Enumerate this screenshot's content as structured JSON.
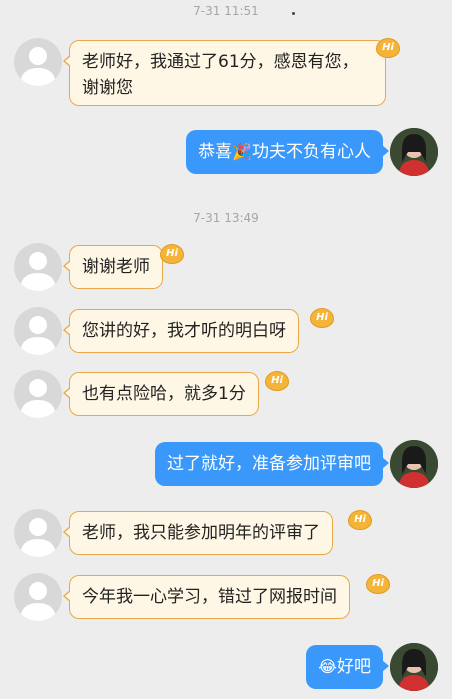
{
  "timestamps": [
    "7-31 11:51",
    "7-31 13:49"
  ],
  "badge_label": "Hi",
  "messages": [
    {
      "side": "left",
      "text": "老师好，我通过了61分，感恩有您，谢谢您"
    },
    {
      "side": "right",
      "before": "恭喜",
      "emoji": "🎉",
      "after": "功夫不负有心人"
    },
    {
      "side": "left",
      "text": "谢谢老师"
    },
    {
      "side": "left",
      "text": "您讲的好，我才听的明白呀"
    },
    {
      "side": "left",
      "text": "也有点险哈，就多1分"
    },
    {
      "side": "right",
      "text": "过了就好，准备参加评审吧"
    },
    {
      "side": "left",
      "text": "老师，我只能参加明年的评审了"
    },
    {
      "side": "left",
      "text": "今年我一心学习，错过了网报时间"
    },
    {
      "side": "right",
      "emoji": "😂",
      "after": "好吧"
    }
  ]
}
